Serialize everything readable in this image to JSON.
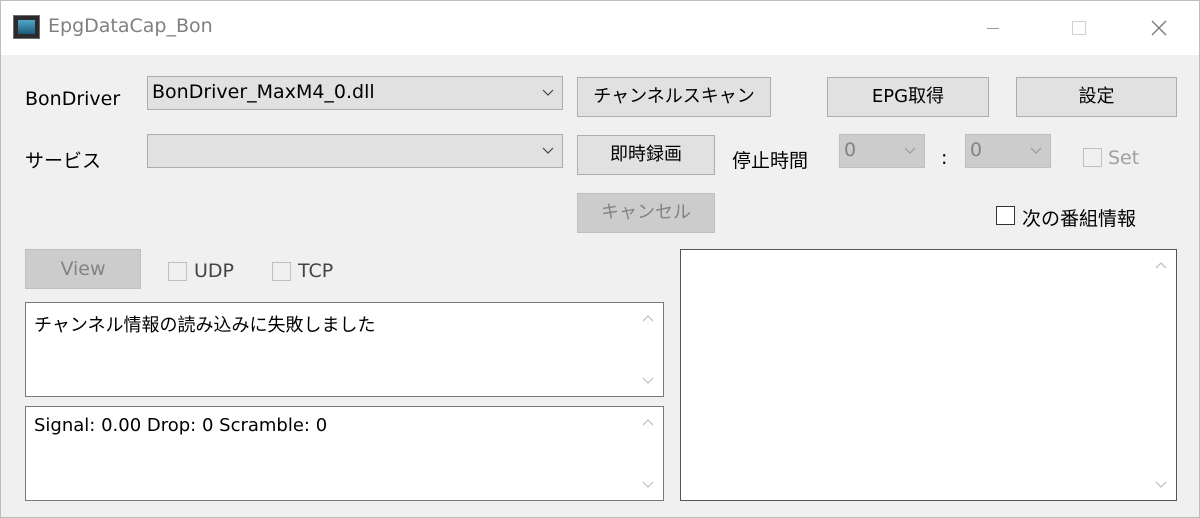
{
  "window": {
    "title": "EpgDataCap_Bon",
    "icon": "app-icon"
  },
  "labels": {
    "bondriver": "BonDriver",
    "service": "サービス",
    "stop_time": "停止時間",
    "colon": ":"
  },
  "bondriver_select": {
    "value": "BonDriver_MaxM4_0.dll"
  },
  "service_select": {
    "value": ""
  },
  "stop_hour": {
    "value": "0"
  },
  "stop_minute": {
    "value": "0"
  },
  "buttons": {
    "channel_scan": "チャンネルスキャン",
    "epg_get": "EPG取得",
    "settings": "設定",
    "instant_record": "即時録画",
    "cancel": "キャンセル",
    "view": "View"
  },
  "checkboxes": {
    "set": {
      "label": "Set",
      "checked": false
    },
    "next_program": {
      "label": "次の番組情報",
      "checked": false
    },
    "udp": {
      "label": "UDP",
      "checked": false
    },
    "tcp": {
      "label": "TCP",
      "checked": false
    }
  },
  "log": {
    "text": "チャンネル情報の読み込みに失敗しました"
  },
  "status": {
    "text": "Signal: 0.00 Drop: 0 Scramble: 0"
  },
  "info_panel": {
    "text": ""
  }
}
